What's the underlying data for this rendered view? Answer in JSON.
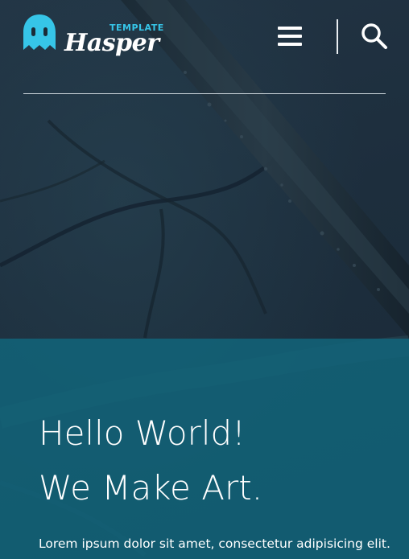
{
  "header": {
    "logo": {
      "small_text": "TEMPLATE",
      "name": "Hasper",
      "icon": "ghost-logo-icon"
    },
    "menu_icon": "hamburger-menu-icon",
    "search_icon": "search-icon"
  },
  "hero": {
    "line1": "Hello World!",
    "line2": "We Make Art.",
    "paragraph": "Lorem ipsum dolor sit amet, consectetur adipisicing elit."
  },
  "colors": {
    "teal_overlay": "#11677c",
    "logo_accent": "#36c5e8",
    "background": "#1a2a38"
  }
}
